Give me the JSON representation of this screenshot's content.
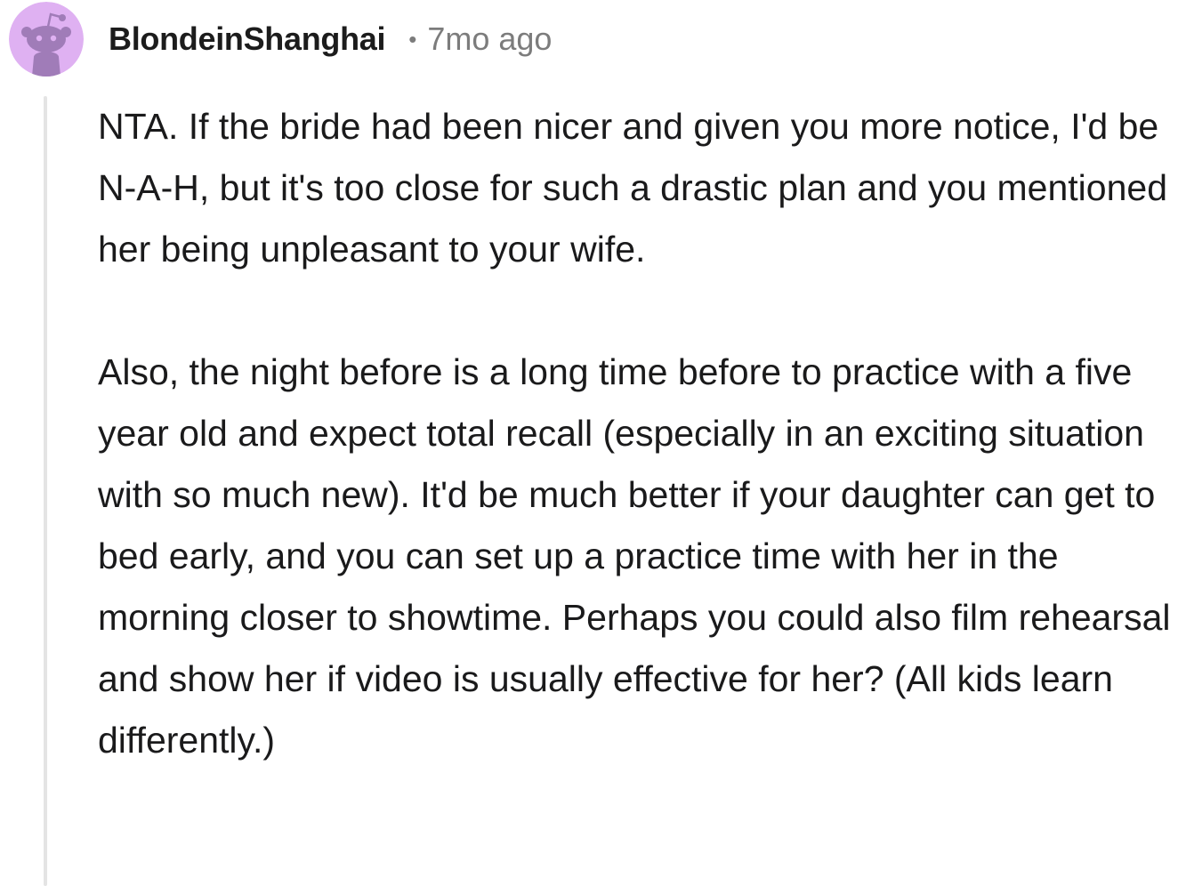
{
  "comment": {
    "username": "BlondeinShanghai",
    "separator": "•",
    "timestamp": "7mo ago",
    "avatar_icon": "snoo-avatar-icon",
    "colors": {
      "avatar_background": "#dfb1f2",
      "avatar_figure": "#a07cb8",
      "username": "#1c1c1c",
      "meta": "#7c7c7c",
      "thread_line": "#e4e4e4"
    },
    "paragraphs": [
      "NTA. If the bride had been nicer and given you more notice, I'd be N-A-H, but it's too close for such a drastic plan and you mentioned her being unpleasant to your wife.",
      "Also, the night before is a long time before to practice with a five year old and expect total recall (especially in an exciting situation with so much new). It'd be much better if your daughter can get to bed early, and you can set up a practice time with her in the morning closer to showtime. Perhaps you could also film rehearsal and show her if video is usually effective for her? (All kids learn differently.)"
    ]
  }
}
